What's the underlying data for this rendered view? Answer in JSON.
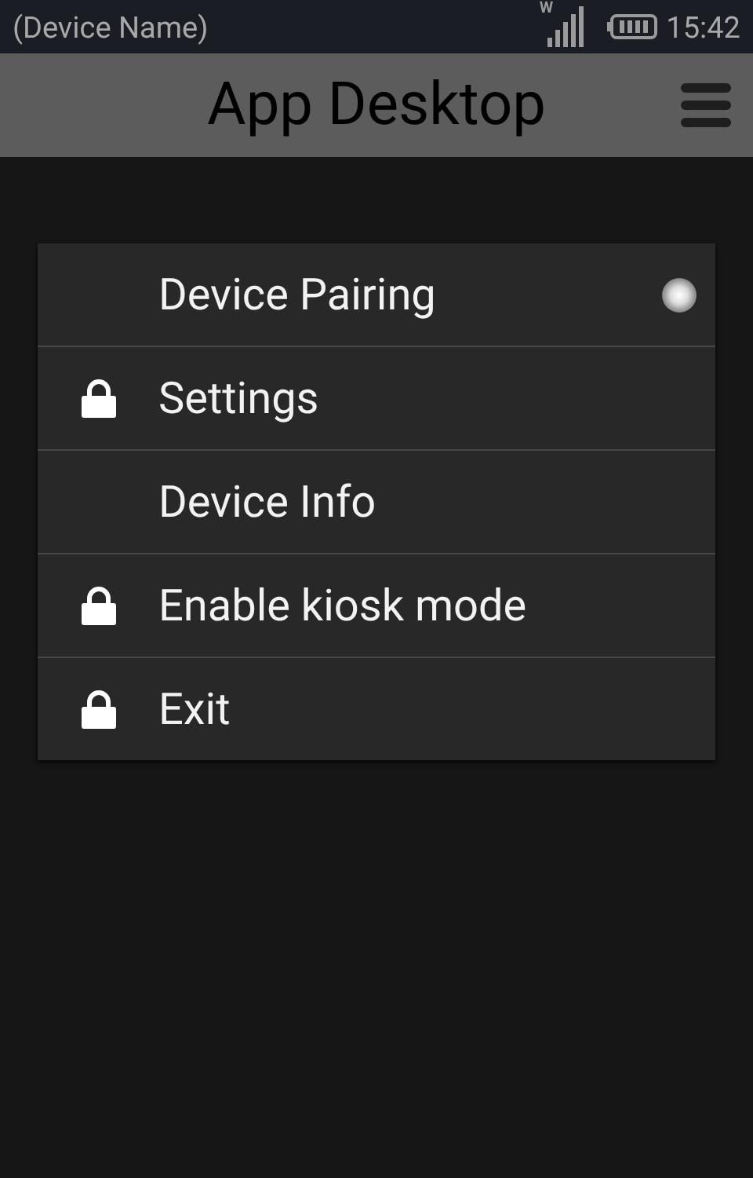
{
  "status_bar": {
    "device_name": "(Device Name)",
    "network_label": "W",
    "time": "15:42"
  },
  "header": {
    "title": "App Desktop"
  },
  "menu": {
    "items": [
      {
        "label": "Device Pairing",
        "locked": false,
        "indicator": true
      },
      {
        "label": "Settings",
        "locked": true,
        "indicator": false
      },
      {
        "label": "Device Info",
        "locked": false,
        "indicator": false
      },
      {
        "label": "Enable kiosk mode",
        "locked": true,
        "indicator": false
      },
      {
        "label": "Exit",
        "locked": true,
        "indicator": false
      }
    ]
  }
}
